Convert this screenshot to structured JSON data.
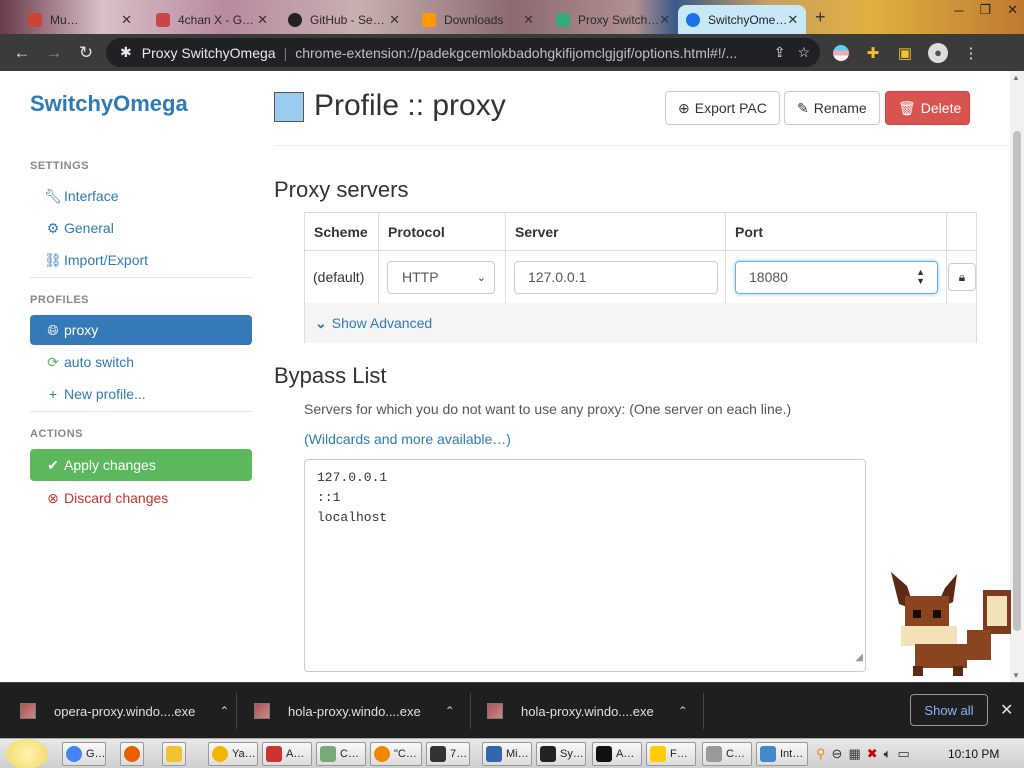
{
  "browser": {
    "tabs": [
      {
        "title": "Mu…",
        "color": "#c43"
      },
      {
        "title": "4chan X - G…",
        "color": "#c44"
      },
      {
        "title": "GitHub - Se…",
        "color": "#222"
      },
      {
        "title": "Downloads",
        "color": "#f90"
      },
      {
        "title": "Proxy Switch…",
        "color": "#3a7"
      },
      {
        "title": "SwitchyOme…",
        "color": "#1a73e8"
      }
    ],
    "new_tab_glyph": "+",
    "window_controls": [
      "─",
      "❐",
      "✕"
    ],
    "omnibox": {
      "page_title": "Proxy SwitchyOmega",
      "url": "chrome-extension://padekgcemlokbadohgkifijomclgjgif/options.html#!/..."
    }
  },
  "sidebar": {
    "brand": "SwitchyOmega",
    "settings_title": "SETTINGS",
    "settings_items": [
      {
        "label": "Interface",
        "icon": "wrench-icon"
      },
      {
        "label": "General",
        "icon": "gear-icon"
      },
      {
        "label": "Import/Export",
        "icon": "hierarchy-icon"
      }
    ],
    "profiles_title": "PROFILES",
    "profile_items": [
      {
        "label": "proxy",
        "icon": "globe-icon"
      },
      {
        "label": "auto switch",
        "icon": "refresh-icon"
      },
      {
        "label": "New profile...",
        "icon": "plus-icon"
      }
    ],
    "actions_title": "ACTIONS",
    "apply_label": "Apply changes",
    "discard_label": "Discard changes"
  },
  "main": {
    "title": "Profile :: proxy",
    "profile_color": "#99ccee",
    "export_label": "Export PAC",
    "rename_label": "Rename",
    "delete_label": "Delete",
    "proxy_heading": "Proxy servers",
    "columns": [
      "Scheme",
      "Protocol",
      "Server",
      "Port"
    ],
    "row": {
      "scheme": "(default)",
      "protocol": "HTTP",
      "server": "127.0.0.1",
      "port": "18080"
    },
    "show_advanced": "Show Advanced",
    "bypass_heading": "Bypass List",
    "bypass_help": "Servers for which you do not want to use any proxy: (One server on each line.)",
    "wildcards_link": "(Wildcards and more available…)",
    "bypass_lines": [
      "127.0.0.1",
      "::1",
      "localhost"
    ]
  },
  "downloads": {
    "items": [
      "opera-proxy.windo....exe",
      "hola-proxy.windo....exe",
      "hola-proxy.windo....exe"
    ],
    "show_all": "Show all"
  },
  "taskbar": {
    "buttons": [
      {
        "label": "G…",
        "color": "#4285f4"
      },
      {
        "label": "",
        "color": "#e66000"
      },
      {
        "label": "",
        "color": "#f2c230"
      },
      {
        "label": "Ya…",
        "color": "#f2b705"
      },
      {
        "label": "A…",
        "color": "#c33"
      },
      {
        "label": "C…",
        "color": "#7a7"
      },
      {
        "label": "\"C…",
        "color": "#e80"
      },
      {
        "label": "7…",
        "color": "#333"
      },
      {
        "label": "Mi…",
        "color": "#36a"
      },
      {
        "label": "Sy…",
        "color": "#222"
      },
      {
        "label": "A…",
        "color": "#111"
      },
      {
        "label": "F…",
        "color": "#fc0"
      },
      {
        "label": "C…",
        "color": "#999"
      },
      {
        "label": "Int…",
        "color": "#48c"
      }
    ],
    "clock": "10:10 PM"
  }
}
